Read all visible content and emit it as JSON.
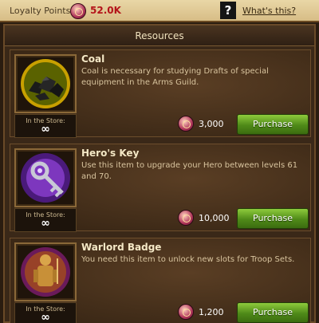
{
  "header": {
    "loyalty_label": "Loyalty Points",
    "loyalty_value": "52.0K",
    "help_symbol": "?",
    "whats_this": "What's this?"
  },
  "section_title": "Resources",
  "items": [
    {
      "title": "Coal",
      "description": "Coal is necessary for studying Drafts of special equipment in the Arms Guild.",
      "store_label": "In the Store:",
      "store_value": "∞",
      "price": "3,000",
      "button": "Purchase",
      "icon": "coal-icon"
    },
    {
      "title": "Hero's Key",
      "description": "Use this item to upgrade your Hero between levels 61 and 70.",
      "store_label": "In the Store:",
      "store_value": "∞",
      "price": "10,000",
      "button": "Purchase",
      "icon": "key-icon"
    },
    {
      "title": "Warlord Badge",
      "description": "You need this item to unlock new slots for Troop Sets.",
      "store_label": "In the Store:",
      "store_value": "∞",
      "price": "1,200",
      "button": "Purchase",
      "icon": "badge-icon"
    }
  ],
  "colors": {
    "accent_green": "#6fae28",
    "loyalty_red": "#b4141a",
    "frame_brown": "#3a2818"
  }
}
